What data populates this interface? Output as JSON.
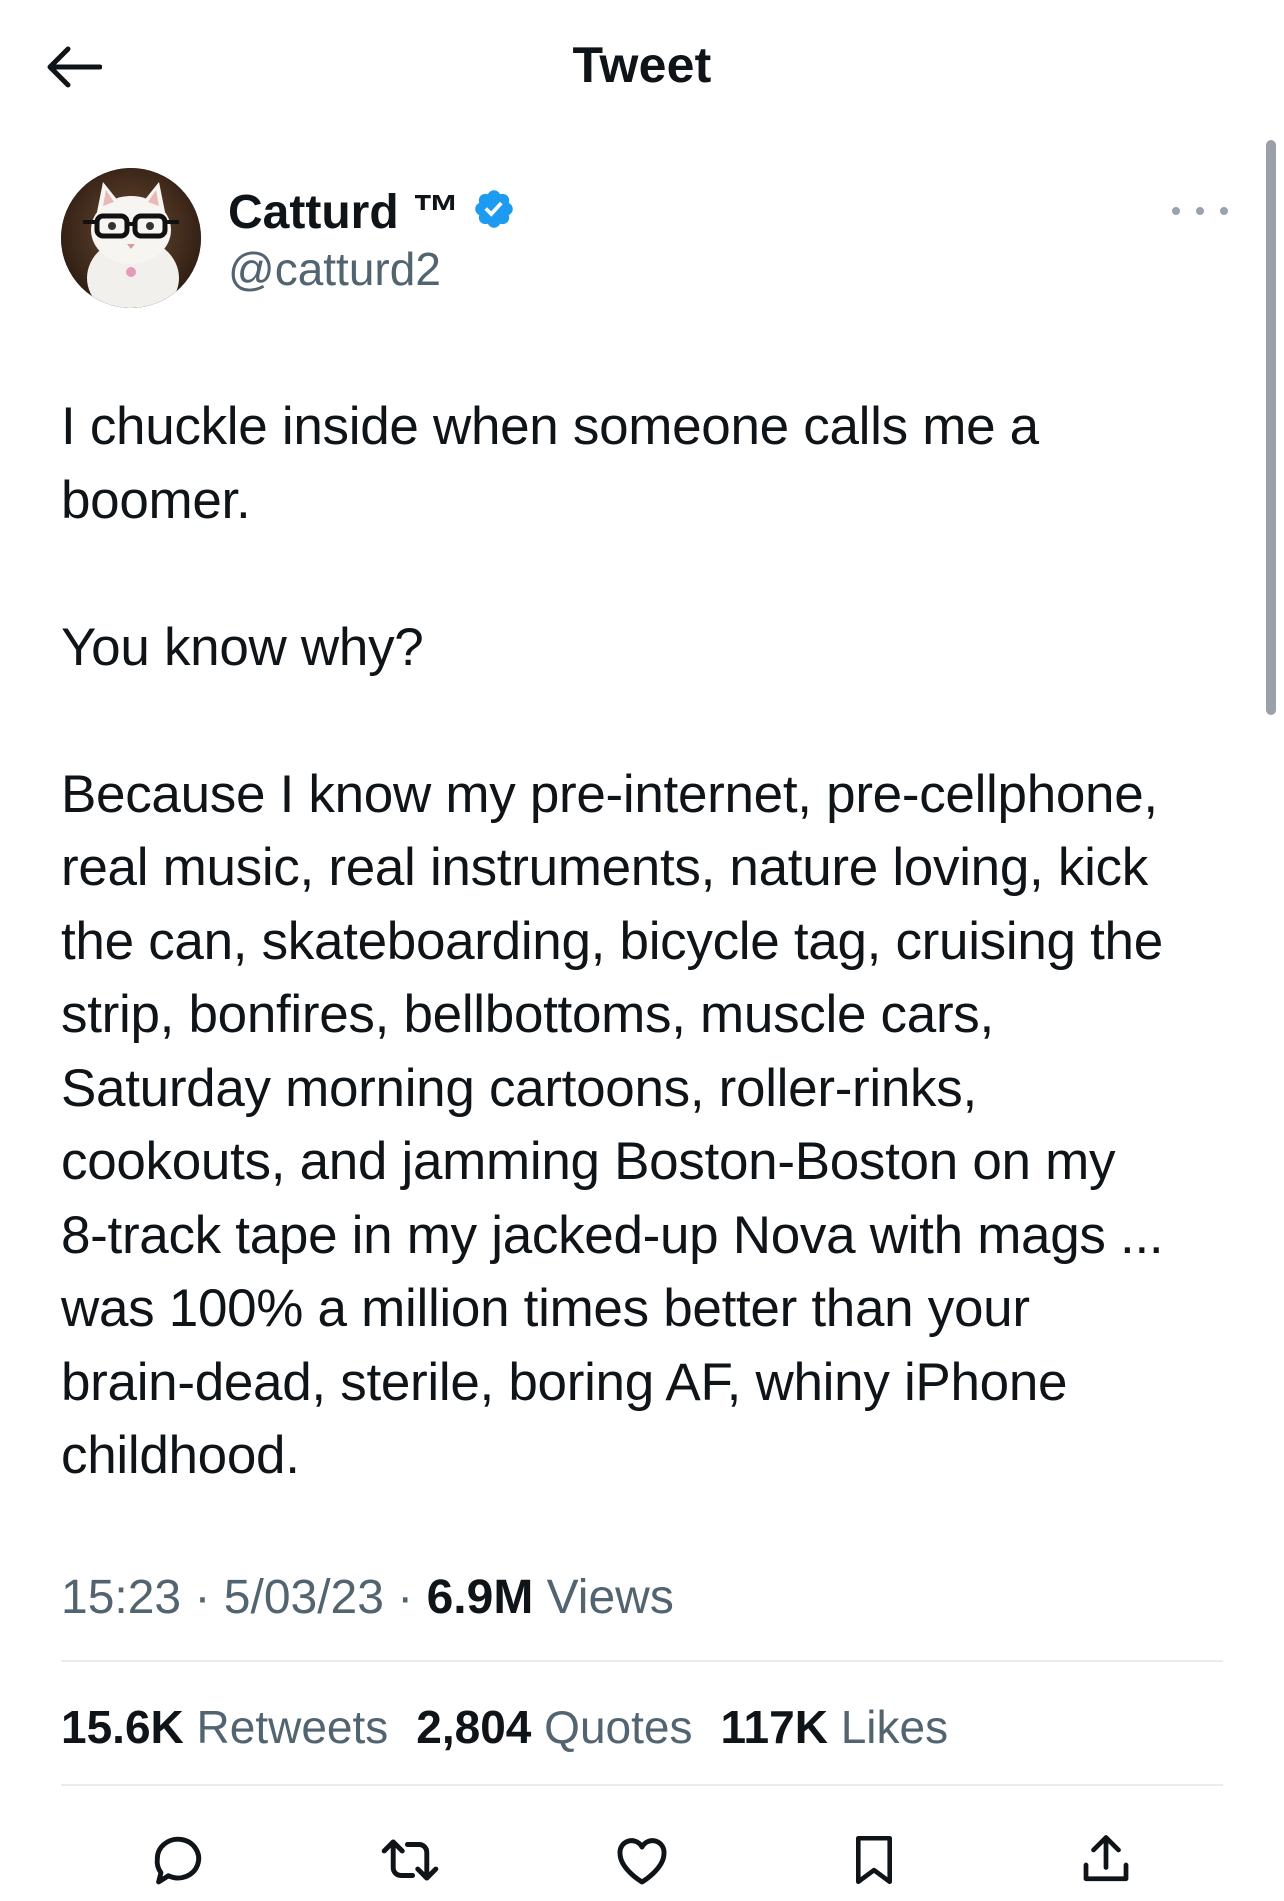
{
  "header": {
    "title": "Tweet"
  },
  "author": {
    "display_name": "Catturd ™",
    "handle": "@catturd2",
    "verified": true,
    "verified_color": "#1d9bf0"
  },
  "tweet": {
    "text": "I chuckle inside when someone calls me a\nboomer.\n\nYou know why?\n\nBecause I know my pre-internet, pre-cellphone,\nreal music, real instruments, nature loving, kick\nthe can, skateboarding, bicycle tag, cruising the\nstrip, bonfires, bellbottoms, muscle cars,\nSaturday morning cartoons, roller-rinks,\ncookouts, and jamming Boston-Boston on my\n8-track tape in my jacked-up Nova with mags ...\nwas 100% a million times better than your\nbrain-dead, sterile, boring AF, whiny iPhone\nchildhood."
  },
  "meta": {
    "time": "15:23",
    "separator": " · ",
    "date": "5/03/23",
    "views_count": "6.9M",
    "views_label": " Views"
  },
  "stats": {
    "retweets_count": "15.6K",
    "retweets_label": " Retweets",
    "quotes_count": "2,804",
    "quotes_label": " Quotes",
    "likes_count": "117K",
    "likes_label": " Likes"
  },
  "icons": {
    "back": "arrow-left-icon",
    "more": "more-horizontal-icon",
    "reply": "reply-icon",
    "retweet": "retweet-icon",
    "like": "heart-icon",
    "bookmark": "bookmark-icon",
    "share": "share-icon"
  }
}
